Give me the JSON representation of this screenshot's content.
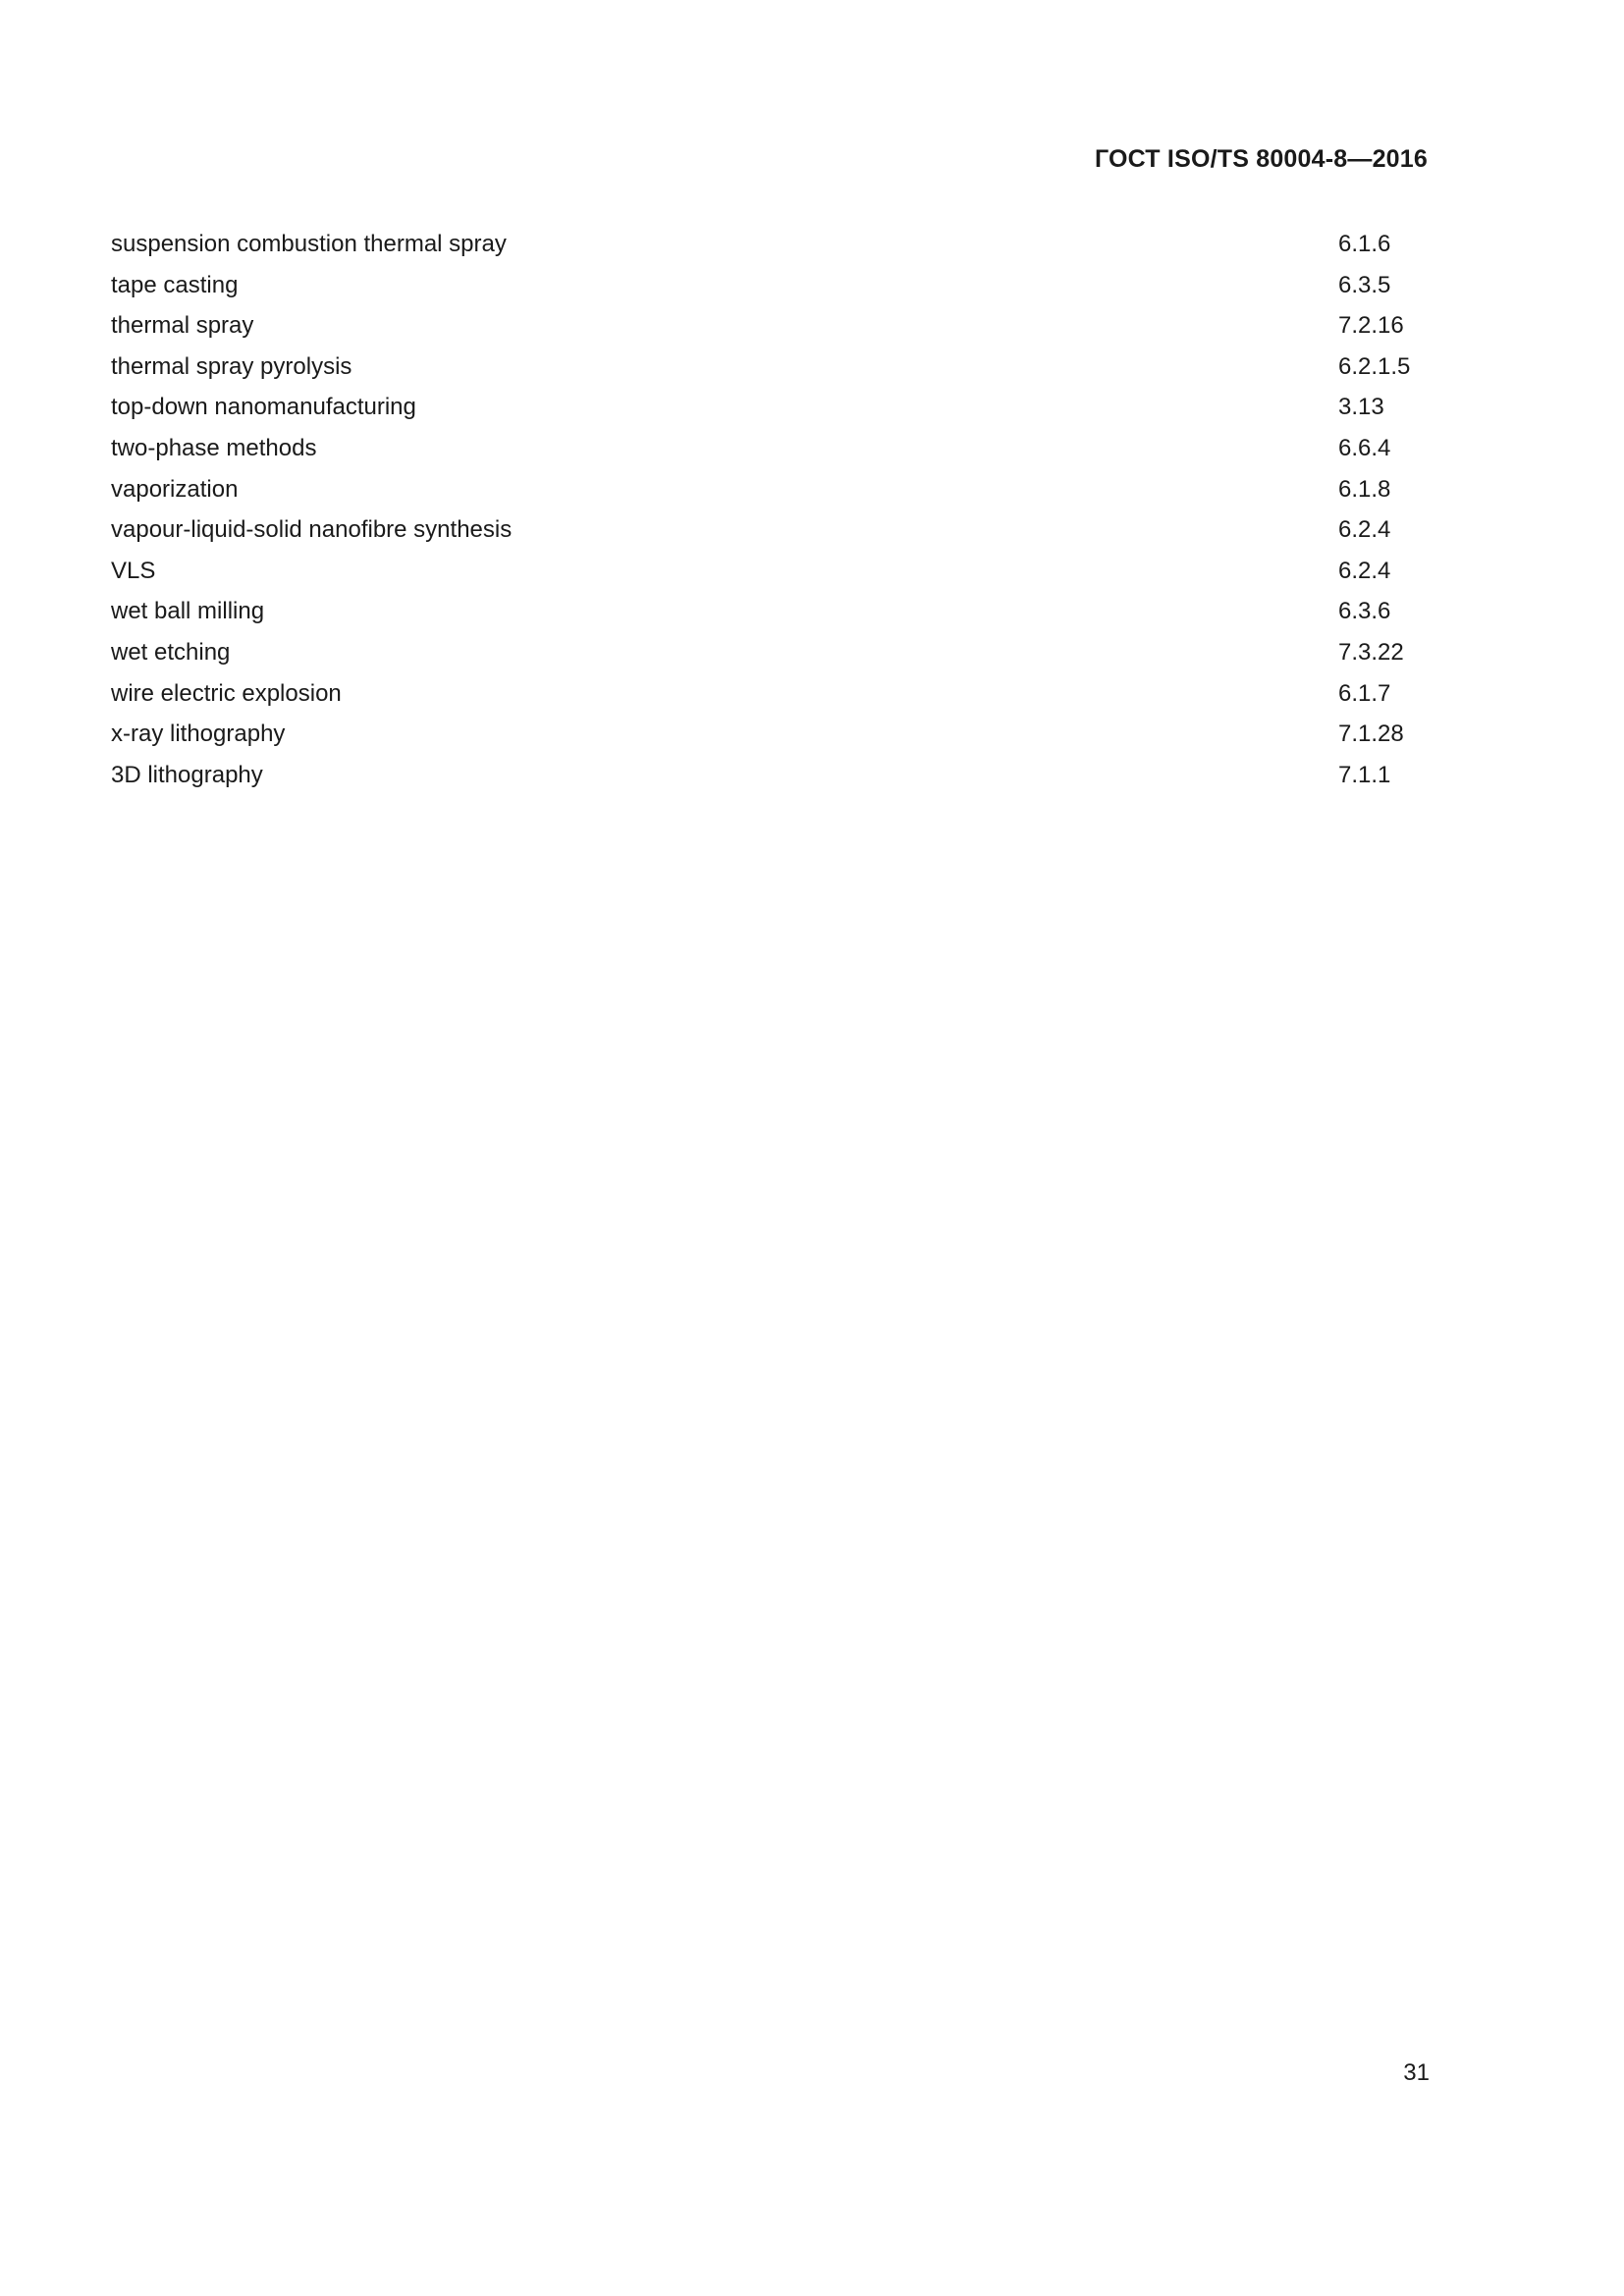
{
  "document": {
    "header": "ГОСТ ISO/TS 80004-8—2016",
    "page_number": "31"
  },
  "index": {
    "entries": [
      {
        "term": "suspension combustion thermal spray",
        "ref": "6.1.6"
      },
      {
        "term": "tape casting",
        "ref": "6.3.5"
      },
      {
        "term": "thermal spray",
        "ref": "7.2.16"
      },
      {
        "term": "thermal spray pyrolysis",
        "ref": "6.2.1.5"
      },
      {
        "term": "top-down nanomanufacturing",
        "ref": "3.13"
      },
      {
        "term": "two-phase methods",
        "ref": "6.6.4"
      },
      {
        "term": "vaporization",
        "ref": "6.1.8"
      },
      {
        "term": "vapour-liquid-solid nanofibre synthesis",
        "ref": "6.2.4"
      },
      {
        "term": "VLS",
        "ref": "6.2.4"
      },
      {
        "term": "wet ball milling",
        "ref": "6.3.6"
      },
      {
        "term": "wet etching",
        "ref": "7.3.22"
      },
      {
        "term": "wire electric explosion",
        "ref": "6.1.7"
      },
      {
        "term": "x-ray lithography",
        "ref": "7.1.28"
      },
      {
        "term": "3D lithography",
        "ref": "7.1.1"
      }
    ]
  }
}
